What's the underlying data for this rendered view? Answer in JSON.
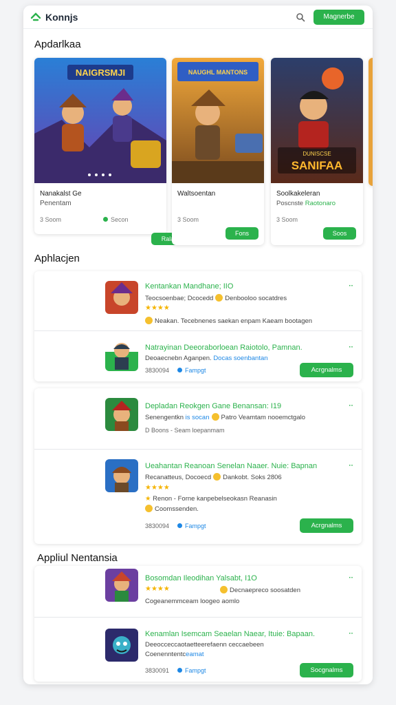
{
  "header": {
    "brand": "Konnjs",
    "cta": "Magnerbe",
    "icons": [
      "logo-icon",
      "search-icon"
    ]
  },
  "sections": {
    "featured": "Apdarlkaa",
    "apps": "Aphlacjen",
    "apps2": "Appliul Nentansia"
  },
  "featured_cards": [
    {
      "title": "Nanakalst Ge",
      "subtitle": "Penentam",
      "meta": "3 Soom",
      "meta2": "Secon",
      "button": "Rala",
      "art_text": "NAIGRSMJI"
    },
    {
      "title": "Waltsoentan",
      "subtitle": "",
      "meta": "3 Soom",
      "meta2": "",
      "button": "Fons",
      "art_text": "NAUGHL MANTONS"
    },
    {
      "title": "Soolkakeleran",
      "subtitle": "Poscnste",
      "subtitle_green": "Raotonaro",
      "meta": "3 Soom",
      "meta2": "",
      "button": "Soos",
      "art_text": "SANIFAA",
      "art_small": "DUNISCSE"
    }
  ],
  "apps_group1": [
    {
      "title": "Kentankan Mandhane; IIO",
      "line1": "Teocsoenbae; Dcocedd",
      "line1b": "Denbooloo socatdres",
      "line2": "Neakan. Tecebnenes saekan enpam Kaeam bootagen",
      "dots": "··"
    },
    {
      "title": "Natrayinan Deeoraborloean Raiotolo, Pamnan.",
      "line1": "Deoaecnebn Aganpen.",
      "line1_blue": "Docas soenbantan",
      "meta": "3830094",
      "meta_blue": "Fampgt",
      "button": "Acrgnalms",
      "dots": "··"
    }
  ],
  "apps_group2": [
    {
      "title": "Depladan Reokgen Gane Benansan: I19",
      "line1": "Senengentkn",
      "line1_blue": "is socan",
      "line1b": "Patro Veamtam nooemctgalo",
      "meta": "D Boons - Seam loepanmam",
      "dots": "··"
    },
    {
      "title": "Ueahantan Reanoan Senelan Naaer. Nuie: Bapnan",
      "line1": "Recanatteus, Docoecd",
      "line1b": "Dankobt. Soks 2806",
      "line2": "Renon - Forne kanpebelseokasn Reanasin",
      "line3": "Coomssenden.",
      "meta": "3830094",
      "meta_blue": "Fampgt",
      "button": "Acrgnalms",
      "dots": "··"
    }
  ],
  "apps_group3": [
    {
      "title": "Bosomdan Ileodihan Yalsabt, I1O",
      "line1b": "Decnaepreco soosatden",
      "line2": "Cogeanemmceam loogeo aomlo",
      "dots": "··"
    },
    {
      "title": "Kenamlan Isemcam Seaelan Naear, Ituie: Bapaan.",
      "line1": "Deeocceccaotaetteerefaenn ceccaebeen",
      "line2": "Coenenntentc",
      "line2_blue": "eamat",
      "meta": "3830091",
      "meta_blue": "Fampgt",
      "button": "Socgnalms",
      "dots": "··"
    }
  ],
  "stars": "★★★★",
  "colors": {
    "accent": "#2bb24c",
    "link": "#1e88e5",
    "star": "#f5b400"
  }
}
